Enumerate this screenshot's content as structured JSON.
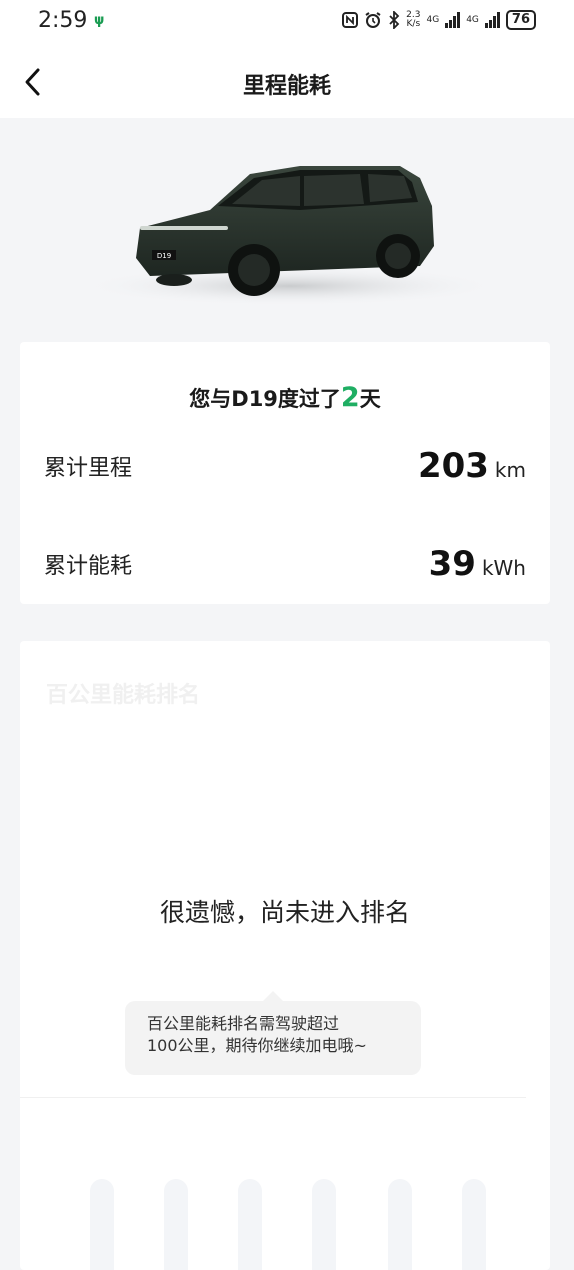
{
  "status_bar": {
    "time": "2:59",
    "app_indicator": "ψ",
    "icons": [
      "nfc-icon",
      "alarm-icon",
      "bluetooth-icon"
    ],
    "net_speed_value": "2.3",
    "net_speed_unit": "K/s",
    "signal_label_1": "4G",
    "signal_label_2": "4G",
    "battery": "76"
  },
  "nav": {
    "title": "里程能耗",
    "back_icon": "chevron-left-icon"
  },
  "hero": {
    "plate": "D19",
    "car_color": "#2b352e"
  },
  "summary": {
    "days_prefix": "您与D19度过了",
    "days_count": "2",
    "days_suffix": "天",
    "mileage_label": "累计里程",
    "mileage_value": "203",
    "mileage_unit": "km",
    "energy_label": "累计能耗",
    "energy_value": "39",
    "energy_unit": "kWh"
  },
  "ranking": {
    "faded_title": "百公里能耗排名",
    "message": "很遗憾，尚未进入排名",
    "tooltip_line1": "百公里能耗排名需驾驶超过",
    "tooltip_line2": "100公里，期待你继续加电哦~"
  },
  "colors": {
    "accent": "#1fae63",
    "page_bg": "#f4f5f7",
    "card_bg": "#ffffff"
  }
}
